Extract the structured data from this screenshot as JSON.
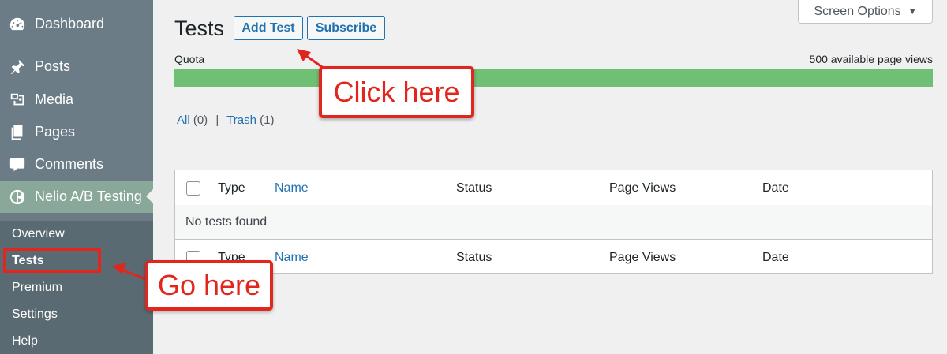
{
  "sidebar": {
    "items": [
      {
        "label": "Dashboard",
        "icon": "dashboard-icon"
      },
      {
        "label": "Posts",
        "icon": "pin-icon"
      },
      {
        "label": "Media",
        "icon": "media-icon"
      },
      {
        "label": "Pages",
        "icon": "pages-icon"
      },
      {
        "label": "Comments",
        "icon": "comment-icon"
      },
      {
        "label": "Nelio A/B Testing",
        "icon": "nelio-icon"
      }
    ],
    "submenu": [
      {
        "label": "Overview"
      },
      {
        "label": "Tests"
      },
      {
        "label": "Premium"
      },
      {
        "label": "Settings"
      },
      {
        "label": "Help"
      }
    ]
  },
  "header": {
    "title": "Tests",
    "add_test_label": "Add Test",
    "subscribe_label": "Subscribe",
    "screen_options_label": "Screen Options"
  },
  "quota": {
    "label": "Quota",
    "available_text": "500 available page views",
    "fill_fraction": 1.0
  },
  "filters": {
    "all_label": "All",
    "all_count": "(0)",
    "separator": "|",
    "trash_label": "Trash",
    "trash_count": "(1)"
  },
  "table": {
    "columns": [
      "Type",
      "Name",
      "Status",
      "Page Views",
      "Date"
    ],
    "empty_message": "No tests found"
  },
  "annotations": {
    "click_here": "Click here",
    "go_here": "Go here"
  },
  "colors": {
    "sidebar": "#6b7c86",
    "accent": "#2271b1",
    "quota_fill": "#6fc074",
    "annotation": "#e0261d"
  }
}
